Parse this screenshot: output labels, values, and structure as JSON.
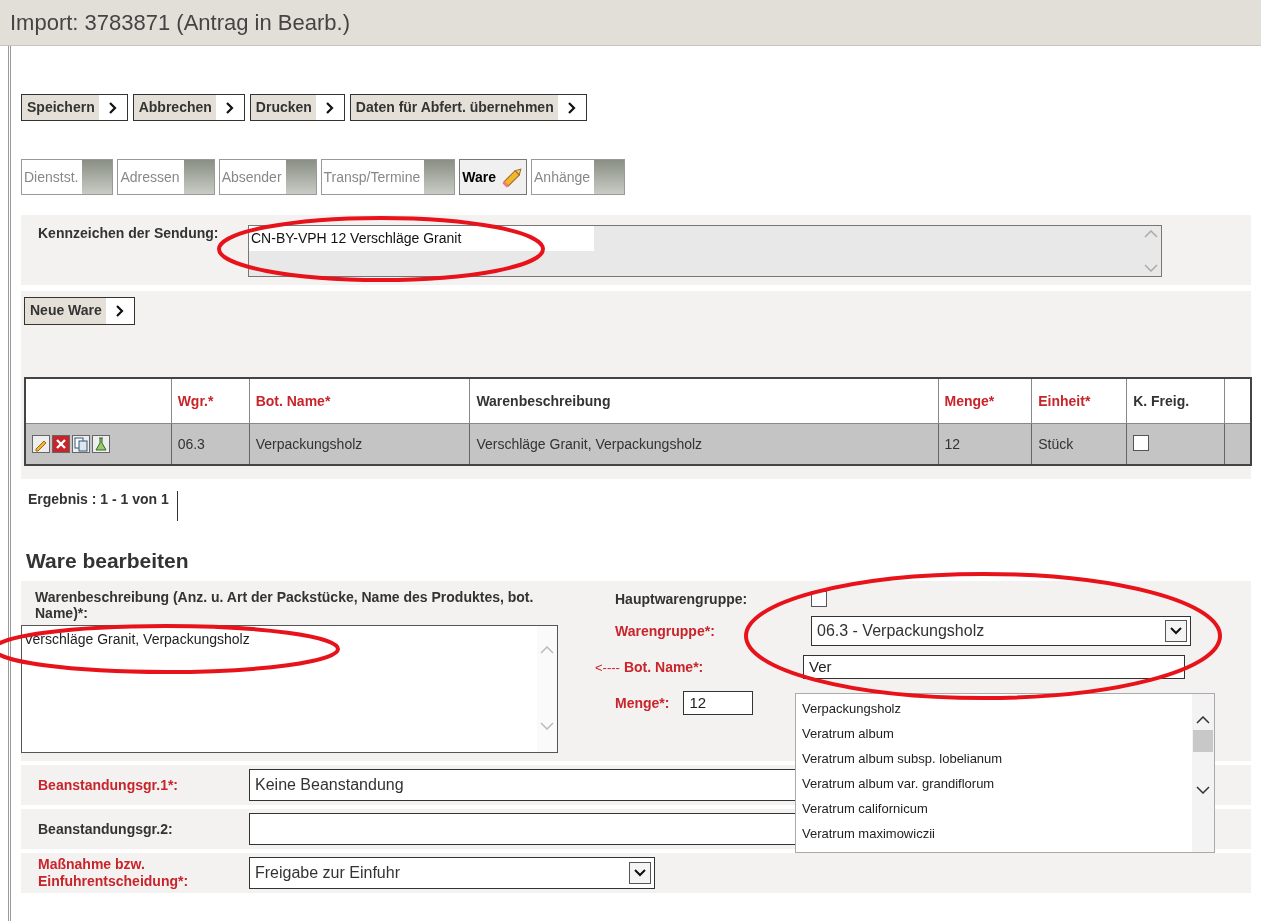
{
  "window": {
    "title": "Import: 3783871 (Antrag in Bearb.)"
  },
  "actions": [
    {
      "label": "Speichern"
    },
    {
      "label": "Abbrechen"
    },
    {
      "label": "Drucken"
    },
    {
      "label": "Daten für Abfert. übernehmen"
    }
  ],
  "tabs": [
    {
      "label": "Dienstst.",
      "selected": false
    },
    {
      "label": "Adressen",
      "selected": false
    },
    {
      "label": "Absender",
      "selected": false
    },
    {
      "label": "Transp/Termine",
      "selected": false
    },
    {
      "label": "Ware",
      "selected": true
    },
    {
      "label": "Anhänge",
      "selected": false
    }
  ],
  "shipment": {
    "label": "Kennzeichen der Sendung:",
    "value": "CN-BY-VPH 12 Verschläge  Granit",
    "circled": true
  },
  "new_item_button": "Neue Ware",
  "table": {
    "columns": [
      {
        "label": "Wgr.*",
        "required": true
      },
      {
        "label": "Bot. Name*",
        "required": true
      },
      {
        "label": "Warenbeschreibung",
        "required": false
      },
      {
        "label": "Menge*",
        "required": true
      },
      {
        "label": "Einheit*",
        "required": true
      },
      {
        "label": "K. Freig.",
        "required": false
      }
    ],
    "rows": [
      {
        "cells": [
          "06.3",
          "Verpackungsholz",
          "Verschläge Granit, Verpackungsholz",
          "12",
          "Stück"
        ],
        "released": false
      }
    ]
  },
  "pagination": "Ergebnis : 1 - 1 von 1",
  "edit": {
    "heading": "Ware bearbeiten",
    "description": {
      "label": "Warenbeschreibung (Anz. u. Art der Packstücke, Name des Produktes, bot. Name)*:",
      "value": "Verschläge Granit, Verpackungsholz",
      "circled": true
    },
    "main_group": {
      "label": "Hauptwarengruppe:",
      "checked": false
    },
    "group": {
      "label": "Warengruppe*:",
      "value": "06.3 - Verpackungsholz",
      "circled": true
    },
    "bot_name": {
      "arrow": "<----",
      "label": "Bot. Name*:",
      "value": "Ver",
      "suggestions": [
        "Verpackungsholz",
        "Veratrum album",
        "Veratrum album subsp. lobelianum",
        "Veratrum album var. grandiflorum",
        "Veratrum californicum",
        "Veratrum maximowiczii"
      ]
    },
    "quantity": {
      "label": "Menge*:",
      "value": "12"
    }
  },
  "fields": [
    {
      "label": "Beanstandungsgr.1*:",
      "value": "Keine Beanstandung",
      "required": true
    },
    {
      "label": "Beanstandungsgr.2:",
      "required": false
    },
    {
      "label": "Maßnahme bzw. Einfuhrentscheidung*:",
      "value": "Freigabe zur Einfuhr",
      "required": true
    }
  ]
}
